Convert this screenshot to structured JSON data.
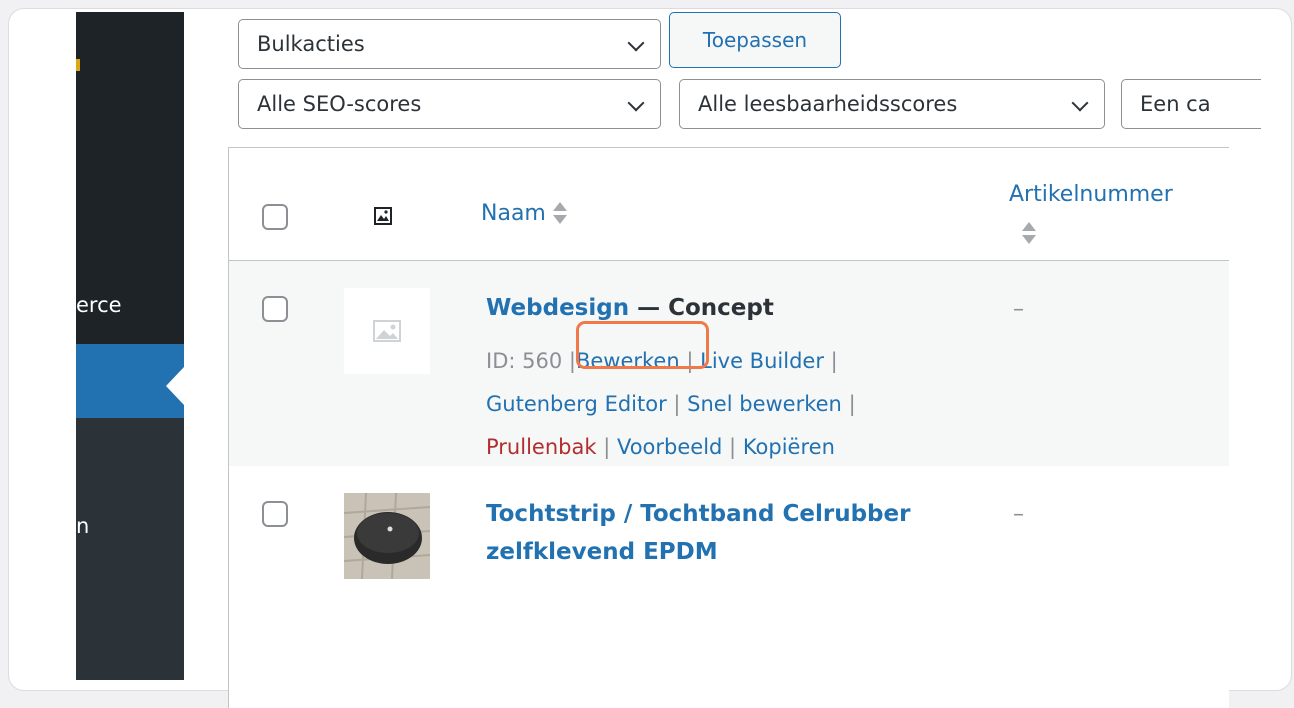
{
  "sidebar": {
    "item_woocommerce_partial": "erce",
    "item_lower_partial": "n"
  },
  "filters": {
    "bulk_actions": "Bulkacties",
    "apply_button": "Toepassen",
    "seo_scores": "Alle SEO-scores",
    "readability_scores": "Alle leesbaarheidsscores",
    "category_partial": "Een ca"
  },
  "table": {
    "columns": {
      "image_icon": "image-icon",
      "name": "Naam",
      "sku": "Artikelnummer"
    },
    "rows": [
      {
        "title": "Webdesign",
        "status": " — Concept",
        "id": "ID: 560",
        "sku": "–",
        "actions": {
          "edit": "Bewerken",
          "live_builder": "Live Builder",
          "gutenberg": "Gutenberg Editor",
          "quick_edit": "Snel bewerken",
          "trash": "Prullenbak",
          "preview": "Voorbeeld",
          "duplicate": "Kopiëren"
        }
      },
      {
        "title_line1": "Tochtstrip / Tochtband Celrubber",
        "title_line2": "zelfklevend EPDM",
        "sku": "–"
      }
    ]
  },
  "separators": "|",
  "colors": {
    "link": "#2271b1",
    "trash": "#b32d2e",
    "highlight": "#f0794a",
    "sidebar": "#1d2327",
    "sidebar_active": "#2271b1"
  }
}
